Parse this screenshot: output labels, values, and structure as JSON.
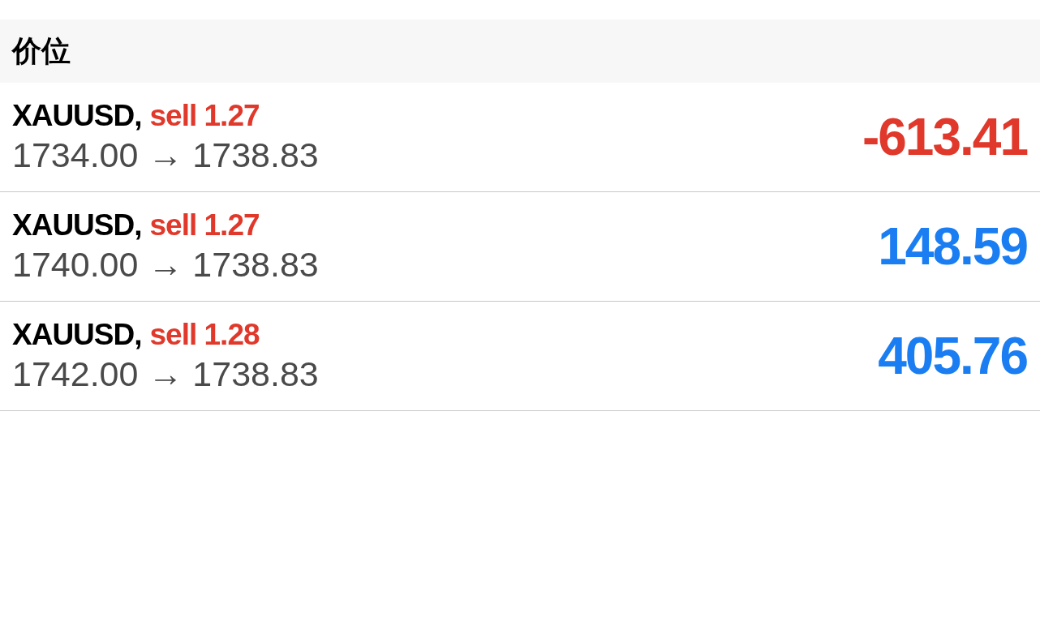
{
  "section_header": "价位",
  "positions": [
    {
      "symbol": "XAUUSD,",
      "order": "sell 1.27",
      "prices": "1734.00 → 1738.83",
      "profit": "-613.41",
      "color": "#e0392b"
    },
    {
      "symbol": "XAUUSD,",
      "order": "sell 1.27",
      "prices": "1740.00 → 1738.83",
      "profit": "148.59",
      "color": "#1a7ef2"
    },
    {
      "symbol": "XAUUSD,",
      "order": "sell 1.28",
      "prices": "1742.00 → 1738.83",
      "profit": "405.76",
      "color": "#1a7ef2"
    }
  ]
}
